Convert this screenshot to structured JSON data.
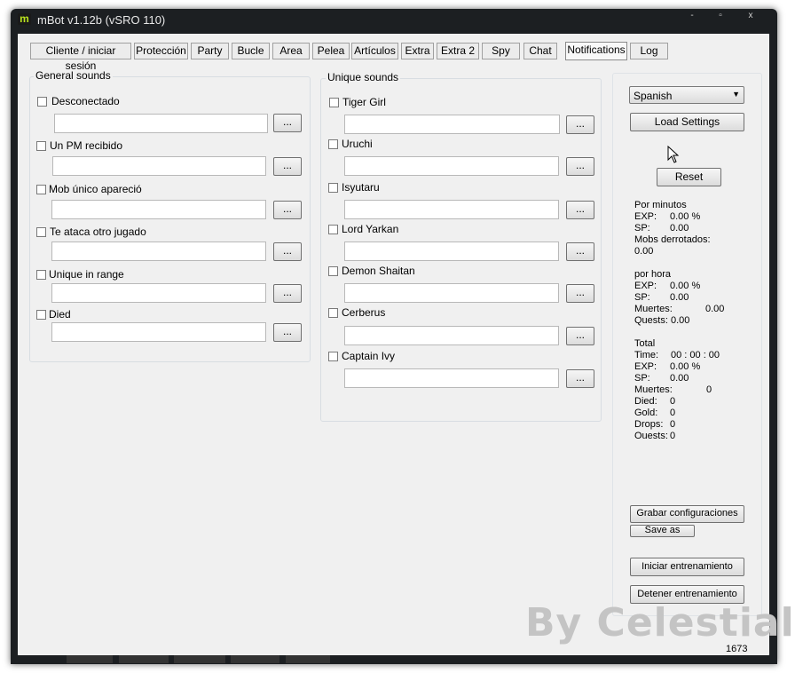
{
  "window": {
    "title": "mBot v1.12b (vSRO 110)",
    "icon_letter": "m",
    "controls": {
      "minimize": "-",
      "maximize": "▫",
      "close": "x"
    }
  },
  "tabs": [
    {
      "label": "Cliente / iniciar sesión"
    },
    {
      "label": "Protección"
    },
    {
      "label": "Party"
    },
    {
      "label": "Bucle"
    },
    {
      "label": "Area"
    },
    {
      "label": "Pelea"
    },
    {
      "label": "Artículos"
    },
    {
      "label": "Extra"
    },
    {
      "label": "Extra 2"
    },
    {
      "label": "Spy"
    },
    {
      "label": "Chat"
    },
    {
      "label": "Notifications",
      "active": true
    },
    {
      "label": "Log"
    }
  ],
  "general_sounds": {
    "title": "General sounds",
    "items": [
      {
        "label": "Desconectado",
        "checked": false,
        "path": "",
        "browse": "..."
      },
      {
        "label": "Un PM recibido",
        "checked": false,
        "path": "",
        "browse": "..."
      },
      {
        "label": "Mob único apareció",
        "checked": false,
        "path": "",
        "browse": "..."
      },
      {
        "label": "Te ataca otro jugado",
        "checked": false,
        "path": "",
        "browse": "..."
      },
      {
        "label": "Unique in range",
        "checked": false,
        "path": "",
        "browse": "..."
      },
      {
        "label": "Died",
        "checked": false,
        "path": "",
        "browse": "..."
      }
    ]
  },
  "unique_sounds": {
    "title": "Unique sounds",
    "items": [
      {
        "label": "Tiger Girl",
        "checked": false,
        "path": "",
        "browse": "..."
      },
      {
        "label": "Uruchi",
        "checked": false,
        "path": "",
        "browse": "..."
      },
      {
        "label": "Isyutaru",
        "checked": false,
        "path": "",
        "browse": "..."
      },
      {
        "label": "Lord Yarkan",
        "checked": false,
        "path": "",
        "browse": "..."
      },
      {
        "label": "Demon Shaitan",
        "checked": false,
        "path": "",
        "browse": "..."
      },
      {
        "label": "Cerberus",
        "checked": false,
        "path": "",
        "browse": "..."
      },
      {
        "label": "Captain Ivy",
        "checked": false,
        "path": "",
        "browse": "..."
      }
    ]
  },
  "right_panel": {
    "language": "Spanish",
    "load_settings": "Load Settings",
    "reset": "Reset",
    "save_config": "Grabar configuraciones",
    "save_as": "Save as",
    "start_training": "Iniciar entrenamiento",
    "stop_training": "Detener entrenamiento",
    "per_minute": {
      "heading": "Por minutos",
      "exp_label": "EXP:",
      "exp_value": "0.00 %",
      "sp_label": "SP:",
      "sp_value": "0.00",
      "mobs_label": "Mobs derrotados:",
      "mobs_value": "0.00"
    },
    "per_hour": {
      "heading": "por hora",
      "exp_label": "EXP:",
      "exp_value": "0.00 %",
      "sp_label": "SP:",
      "sp_value": "0.00",
      "deaths_label": "Muertes:",
      "deaths_value": "0.00",
      "quests_label": "Quests:",
      "quests_value": "0.00"
    },
    "total": {
      "heading": "Total",
      "time_label": "Time:",
      "time_value": "00 : 00 : 00",
      "exp_label": "EXP:",
      "exp_value": "0.00 %",
      "sp_label": "SP:",
      "sp_value": "0.00",
      "deaths_label": "Muertes:",
      "deaths_value": "0",
      "died_label": "Died:",
      "died_value": "0",
      "gold_label": "Gold:",
      "gold_value": "0",
      "drops_label": "Drops:",
      "drops_value": "0",
      "quests_label": "Ouests:",
      "quests_value": "0"
    }
  },
  "watermark": "By Celestial",
  "status_counter": "1673",
  "colors": {
    "accent_icon": "#b8e21e",
    "titlebar": "#1c1f22",
    "client_bg": "#f0f0f0"
  }
}
